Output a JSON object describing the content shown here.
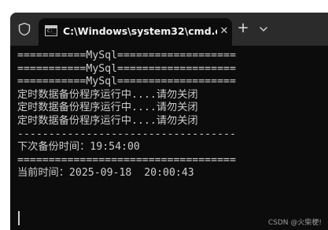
{
  "window": {
    "tab_title": "C:\\Windows\\system32\\cmd.e:",
    "tab_close": "✕",
    "new_tab": "+",
    "colors": {
      "titlebar": "#2b2b2b",
      "console_bg": "#0c0c0c",
      "text": "#cccccc"
    },
    "icons": {
      "shield": "shield-icon",
      "tab": "cmd-icon",
      "dropdown": "chevron-down-icon"
    }
  },
  "console": {
    "lines": [
      "===========MySql===================",
      "===========MySql===================",
      "===========MySql===================",
      "定时数据备份程序运行中....请勿关闭",
      "定时数据备份程序运行中....请勿关闭",
      "定时数据备份程序运行中....请勿关闭",
      "-----------------------------------",
      "下次备份时间：19:54:00",
      "===================================",
      "当前时间：2025-09-18  20:00:43"
    ]
  },
  "watermark": "CSDN @火柴梗!"
}
